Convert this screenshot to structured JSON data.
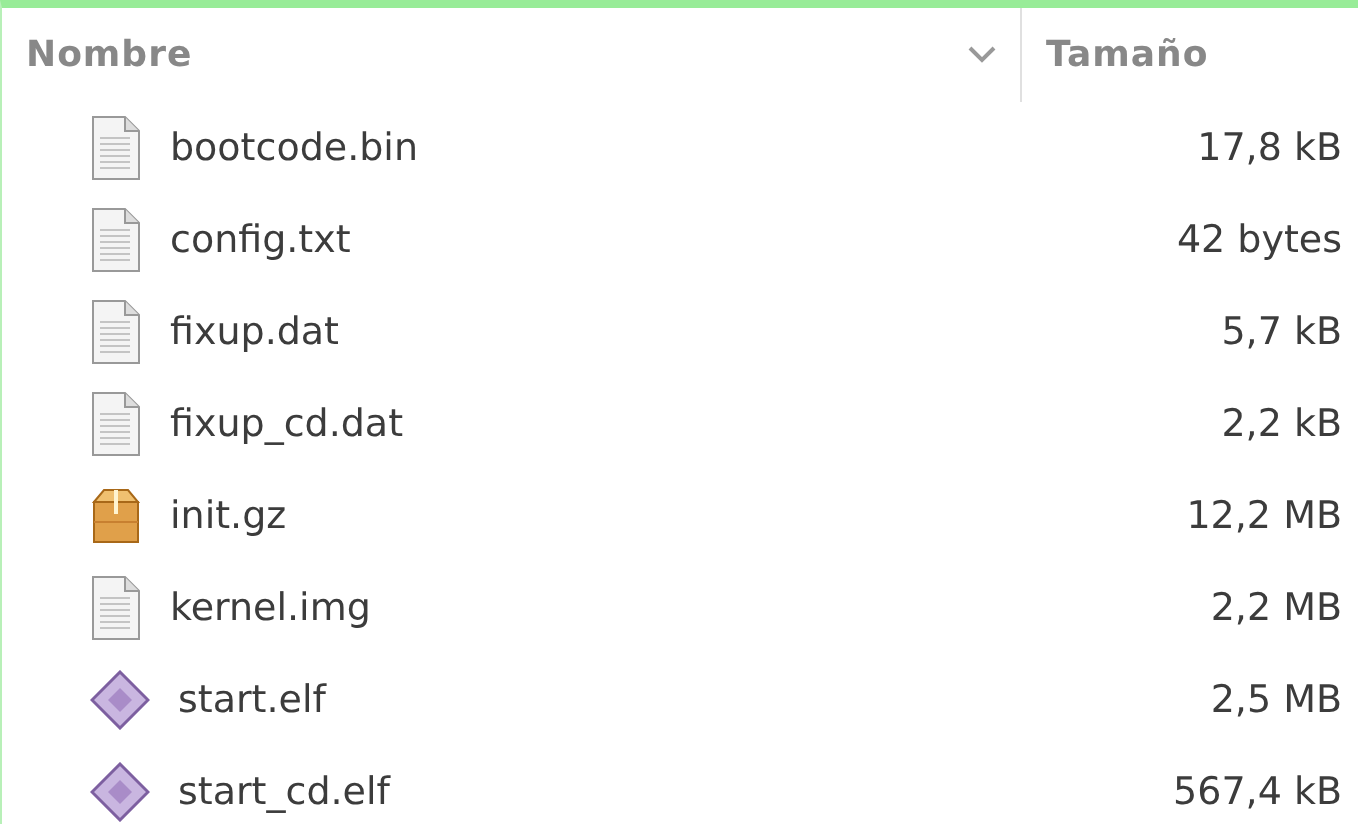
{
  "columns": [
    {
      "label": "Nombre",
      "sorted": true
    },
    {
      "label": "Tamaño",
      "sorted": false
    }
  ],
  "files": [
    {
      "name": "bootcode.bin",
      "size": "17,8 kB",
      "kind": "text"
    },
    {
      "name": "config.txt",
      "size": "42 bytes",
      "kind": "text"
    },
    {
      "name": "fixup.dat",
      "size": "5,7 kB",
      "kind": "text"
    },
    {
      "name": "fixup_cd.dat",
      "size": "2,2 kB",
      "kind": "text"
    },
    {
      "name": "init.gz",
      "size": "12,2 MB",
      "kind": "archive"
    },
    {
      "name": "kernel.img",
      "size": "2,2 MB",
      "kind": "text"
    },
    {
      "name": "start.elf",
      "size": "2,5 MB",
      "kind": "binary"
    },
    {
      "name": "start_cd.elf",
      "size": "567,4 kB",
      "kind": "binary"
    }
  ]
}
